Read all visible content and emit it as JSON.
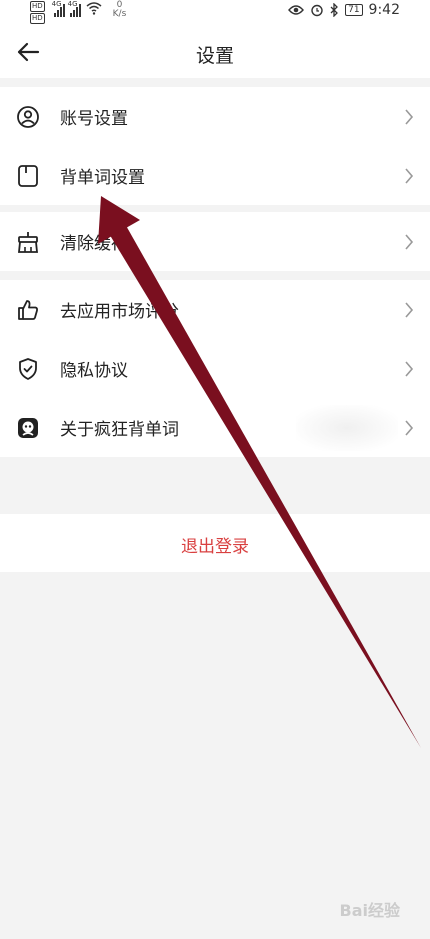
{
  "status_bar": {
    "hd1": "HD",
    "hd2": "HD",
    "net1": "4G",
    "net2": "4G",
    "speed_value": "0",
    "speed_unit": "K/s",
    "battery": "71",
    "time": "9:42"
  },
  "header": {
    "title": "设置"
  },
  "groups": [
    {
      "items": [
        {
          "label": "账号设置",
          "icon": "user-icon"
        },
        {
          "label": "背单词设置",
          "icon": "bookmark-icon"
        }
      ]
    },
    {
      "items": [
        {
          "label": "清除缓存",
          "icon": "broom-icon"
        }
      ]
    },
    {
      "items": [
        {
          "label": "去应用市场评分",
          "icon": "thumbs-up-icon"
        },
        {
          "label": "隐私协议",
          "icon": "shield-icon"
        },
        {
          "label": "关于疯狂背单词",
          "icon": "app-logo-icon"
        }
      ]
    }
  ],
  "logout": {
    "label": "退出登录"
  },
  "colors": {
    "accent_red": "#d94040",
    "annotation_arrow": "#7a0f1f",
    "background": "#f3f3f3"
  },
  "watermark": "Bai经验"
}
